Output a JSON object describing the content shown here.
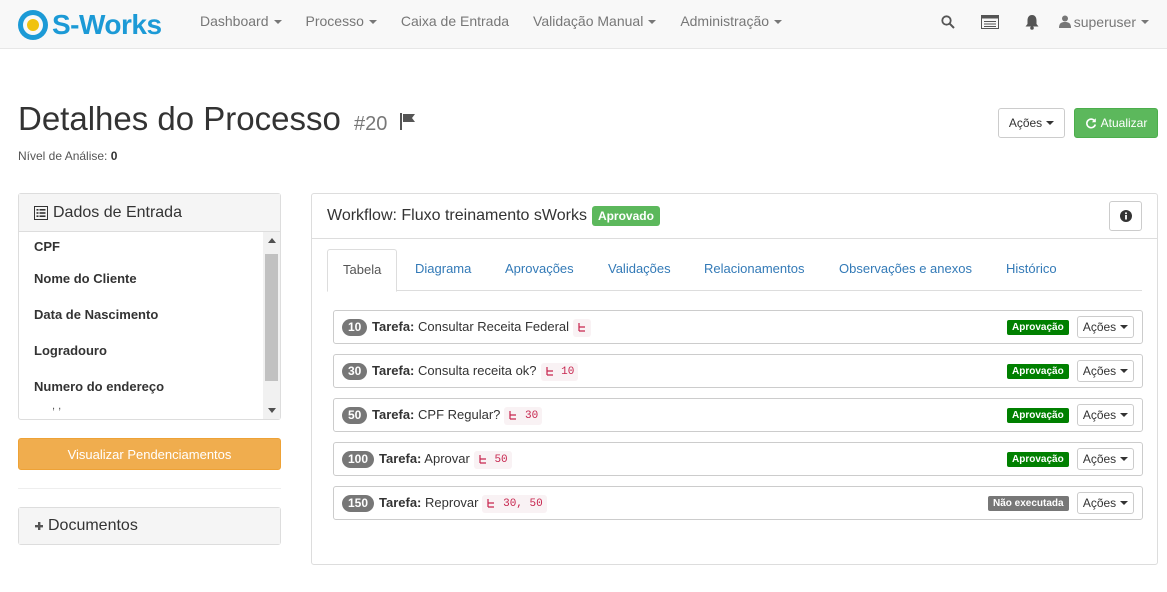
{
  "nav": {
    "brand": "S-Works",
    "items": [
      {
        "label": "Dashboard",
        "dropdown": true
      },
      {
        "label": "Processo",
        "dropdown": true
      },
      {
        "label": "Caixa de Entrada",
        "dropdown": false
      },
      {
        "label": "Validação Manual",
        "dropdown": true
      },
      {
        "label": "Administração",
        "dropdown": true
      }
    ],
    "user": "superuser",
    "icons": [
      "search-icon",
      "inbox-icon",
      "bell-icon",
      "user-icon"
    ]
  },
  "header": {
    "title": "Detalhes do Processo",
    "number": "#20",
    "nivel_label": "Nível de Análise:",
    "nivel_value": "0",
    "acoes_label": "Ações",
    "atualizar_label": "Atualizar"
  },
  "entrada": {
    "title": "Dados de Entrada",
    "items": [
      "CPF",
      "Nome do Cliente",
      "Data de Nascimento",
      "Logradouro",
      "Numero do endereço"
    ],
    "partial": ", ,",
    "button": "Visualizar Pendenciamentos"
  },
  "documentos": {
    "title": "Documentos"
  },
  "workflow": {
    "prefix": "Workflow:",
    "name": "Fluxo treinamento sWorks",
    "status": "Aprovado",
    "tabs": [
      "Tabela",
      "Diagrama",
      "Aprovações",
      "Validações",
      "Relacionamentos",
      "Observações e anexos",
      "Histórico"
    ],
    "tasks": [
      {
        "id": "10",
        "label": "Tarefa:",
        "name": "Consultar Receita Federal",
        "deps": "",
        "status": "Aprovação",
        "status_type": "ok",
        "acoes": "Ações"
      },
      {
        "id": "30",
        "label": "Tarefa:",
        "name": "Consulta receita ok?",
        "deps": "10",
        "status": "Aprovação",
        "status_type": "ok",
        "acoes": "Ações"
      },
      {
        "id": "50",
        "label": "Tarefa:",
        "name": "CPF Regular?",
        "deps": "30",
        "status": "Aprovação",
        "status_type": "ok",
        "acoes": "Ações"
      },
      {
        "id": "100",
        "label": "Tarefa:",
        "name": "Aprovar",
        "deps": "50",
        "status": "Aprovação",
        "status_type": "ok",
        "acoes": "Ações"
      },
      {
        "id": "150",
        "label": "Tarefa:",
        "name": "Reprovar",
        "deps": "30, 50",
        "status": "Não executada",
        "status_type": "no",
        "acoes": "Ações"
      }
    ]
  },
  "colors": {
    "brand": "#1c9ad6",
    "success": "#5cb85c",
    "warning": "#f0ad4e",
    "status_ok": "#008000",
    "status_default": "#777777",
    "link": "#337ab7"
  }
}
